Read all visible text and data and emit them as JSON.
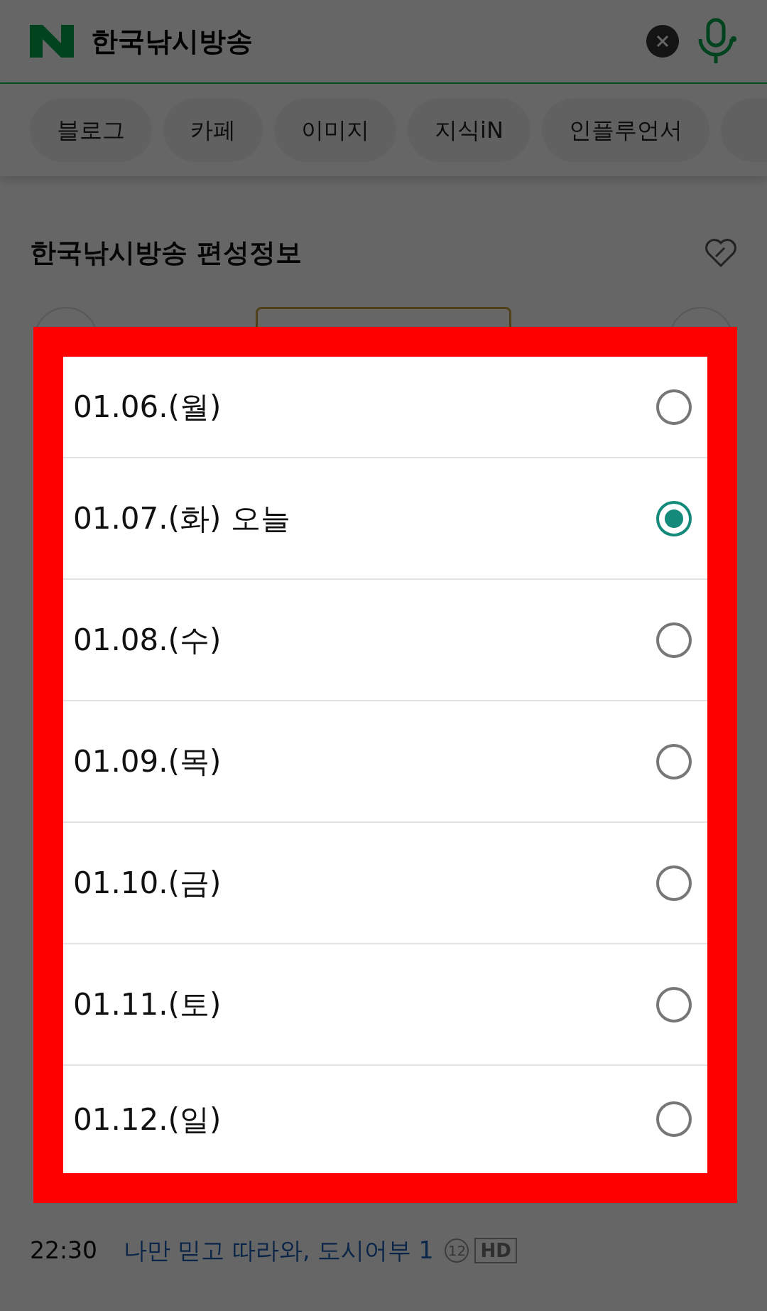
{
  "search": {
    "query": "한국낚시방송"
  },
  "tabs": [
    {
      "label": "블로그"
    },
    {
      "label": "카페"
    },
    {
      "label": "이미지"
    },
    {
      "label": "지식iN"
    },
    {
      "label": "인플루언서"
    }
  ],
  "section": {
    "title": "한국낚시방송 편성정보"
  },
  "date_picker": {
    "options": [
      {
        "label": "01.06.(월)",
        "selected": false
      },
      {
        "label": "01.07.(화) 오늘",
        "selected": true
      },
      {
        "label": "01.08.(수)",
        "selected": false
      },
      {
        "label": "01.09.(목)",
        "selected": false
      },
      {
        "label": "01.10.(금)",
        "selected": false
      },
      {
        "label": "01.11.(토)",
        "selected": false
      },
      {
        "label": "01.12.(일)",
        "selected": false
      }
    ]
  },
  "schedule": [
    {
      "time": "22:30",
      "title": "나만 믿고 따라와, 도시어부 1",
      "rating": "12",
      "quality": "HD"
    }
  ]
}
